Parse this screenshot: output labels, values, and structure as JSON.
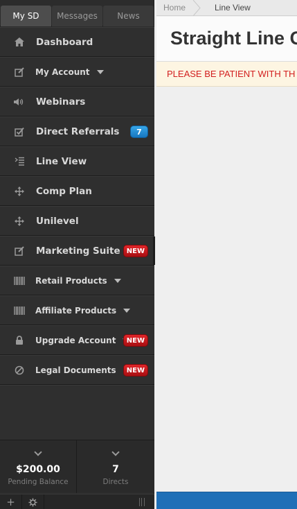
{
  "sidebar": {
    "tabs": [
      {
        "label": "My SD"
      },
      {
        "label": "Messages"
      },
      {
        "label": "News"
      }
    ],
    "items": [
      {
        "label": "Dashboard",
        "icon": "home-icon"
      },
      {
        "label": "My Account",
        "icon": "edit-icon",
        "dropdown": true
      },
      {
        "label": "Webinars",
        "icon": "volume-icon"
      },
      {
        "label": "Direct Referrals",
        "icon": "checkbox-icon",
        "badge": "7"
      },
      {
        "label": "Line View",
        "icon": "indent-list-icon"
      },
      {
        "label": "Comp Plan",
        "icon": "move-arrows-icon"
      },
      {
        "label": "Unilevel",
        "icon": "move-arrows-icon"
      },
      {
        "label": "Marketing Suite",
        "icon": "edit-icon",
        "badge": "NEW"
      },
      {
        "label": "Retail Products",
        "icon": "barcode-icon",
        "dropdown": true
      },
      {
        "label": "Affiliate Products",
        "icon": "barcode-icon",
        "dropdown": true
      },
      {
        "label": "Upgrade Account",
        "icon": "lock-icon",
        "dropdown": true,
        "badge": "NEW"
      },
      {
        "label": "Legal Documents",
        "icon": "ban-icon",
        "dropdown": true,
        "badge": "NEW"
      }
    ],
    "stats": [
      {
        "value": "$200.00",
        "caption": "Pending Balance"
      },
      {
        "value": "7",
        "caption": "Directs"
      }
    ]
  },
  "breadcrumb": {
    "home": "Home",
    "current": "Line View"
  },
  "page": {
    "title": "Straight Line C",
    "alert": "PLEASE BE PATIENT WITH TH"
  },
  "colors": {
    "sidebar_bg": "#2c2c2c",
    "badge_blue": "#1e88d2",
    "badge_red": "#c8171b",
    "alert_text": "#d21e1e",
    "alert_bg": "#fdf5e2",
    "status_bar": "#1f6fb7"
  }
}
